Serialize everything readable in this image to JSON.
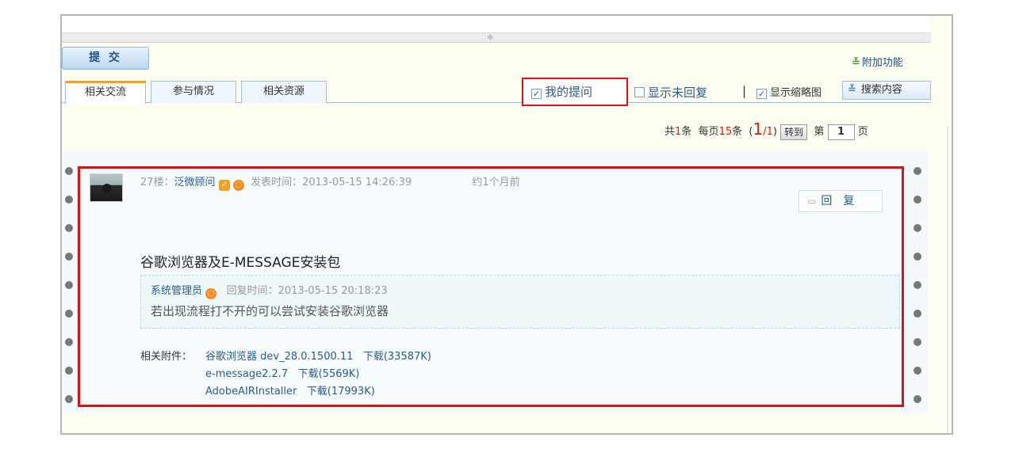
{
  "toolbar": {
    "submit_label": "提 交",
    "addon_label": "附加功能"
  },
  "tabs": [
    {
      "label": "相关交流",
      "active": true
    },
    {
      "label": "参与情况",
      "active": false
    },
    {
      "label": "相关资源",
      "active": false
    }
  ],
  "options": {
    "my_questions": {
      "label": "我的提问",
      "checked": true
    },
    "show_unreplied": {
      "label": "显示未回复",
      "checked": false
    },
    "separator": "|",
    "show_thumbnails": {
      "label": "显示缩略图",
      "checked": true
    },
    "search_label": "搜索内容"
  },
  "pager": {
    "total_prefix": "共",
    "total": "1",
    "total_suffix": "条",
    "per_page_prefix": "每页",
    "per_page": "15",
    "per_page_suffix": "条",
    "open_paren": "(",
    "current": "1",
    "slash": "/1",
    "close_paren": ")",
    "goto_label": "转到",
    "page_prefix": "第",
    "page_value": "1",
    "page_suffix": "页"
  },
  "post": {
    "floor": "27楼：",
    "author": "泛微顾问",
    "posted_label": "发表时间：2013-05-15 14:26:39",
    "relative_time": "约1个月前",
    "reply_label": "回　复",
    "title": "谷歌浏览器及E-MESSAGE安装包",
    "quote": {
      "author": "系统管理员",
      "reply_time": "回复时间：2013-05-15 20:18:23",
      "body": "若出现流程打不开的可以尝试安装谷歌浏览器"
    },
    "attachments_label": "相关附件：",
    "attachments": [
      {
        "name": "谷歌浏览器 dev_28.0.1500.11",
        "download": "下载(33587K)"
      },
      {
        "name": "e-message2.2.7",
        "download": "下载(5569K)"
      },
      {
        "name": "AdobeAIRInstaller",
        "download": "下载(17993K)"
      }
    ]
  },
  "colors": {
    "highlight_border": "#e01010",
    "link": "#2a5a8e",
    "accent_orange": "#f2a122"
  }
}
